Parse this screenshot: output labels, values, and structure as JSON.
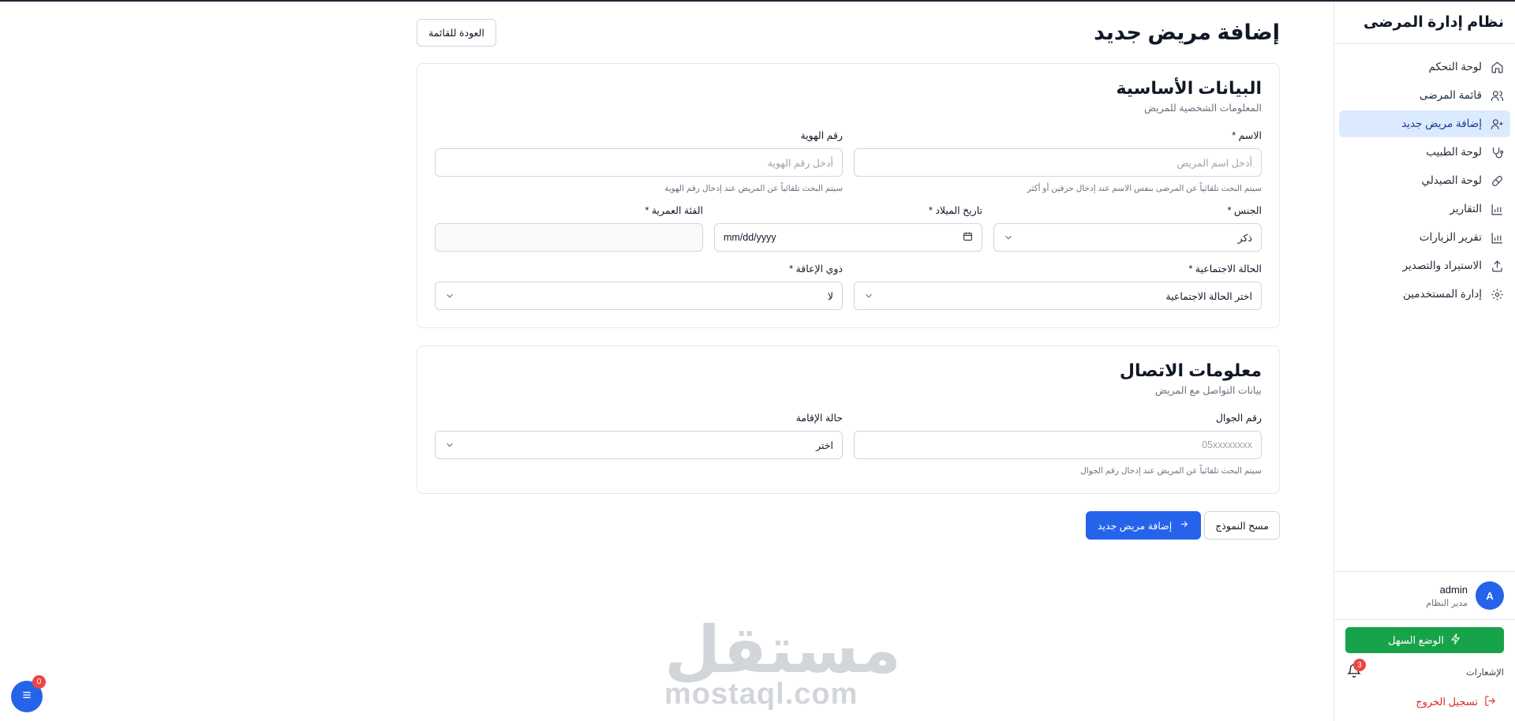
{
  "app": {
    "title": "نظام إدارة المرضى"
  },
  "sidebar": {
    "items": [
      {
        "label": "لوحة التحكم",
        "icon": "home-icon"
      },
      {
        "label": "قائمة المرضى",
        "icon": "users-icon"
      },
      {
        "label": "إضافة مريض جديد",
        "icon": "user-plus-icon",
        "active": true
      },
      {
        "label": "لوحة الطبيب",
        "icon": "stethoscope-icon"
      },
      {
        "label": "لوحة الصيدلي",
        "icon": "pill-icon"
      },
      {
        "label": "التقارير",
        "icon": "bar-chart-icon"
      },
      {
        "label": "تقرير الزيارات",
        "icon": "bar-chart-icon"
      },
      {
        "label": "الاستيراد والتصدير",
        "icon": "upload-icon"
      },
      {
        "label": "إدارة المستخدمين",
        "icon": "gear-icon"
      }
    ],
    "user": {
      "initial": "A",
      "name": "admin",
      "role": "مدير النظام"
    },
    "easy_mode_label": "الوضع السهل",
    "notifications_label": "الإشعارات",
    "notifications_count": "3",
    "logout_label": "تسجيل الخروج"
  },
  "page": {
    "title": "إضافة مريض جديد",
    "back_label": "العودة للقائمة"
  },
  "basic": {
    "title": "البيانات الأساسية",
    "subtitle": "المعلومات الشخصية للمريض",
    "name": {
      "label": "الاسم *",
      "placeholder": "أدخل اسم المريض",
      "hint": "سيتم البحث تلقائياً عن المرضى بنفس الاسم عند إدخال حرفين أو أكثر"
    },
    "id": {
      "label": "رقم الهوية",
      "placeholder": "أدخل رقم الهوية",
      "hint": "سيتم البحث تلقائياً عن المريض عند إدخال رقم الهوية"
    },
    "gender": {
      "label": "الجنس *",
      "value": "ذكر"
    },
    "birth": {
      "label": "تاريخ الميلاد *",
      "value": "mm/dd/yyyy"
    },
    "age_group": {
      "label": "الفئة العمرية *",
      "value": ""
    },
    "social": {
      "label": "الحالة الاجتماعية *",
      "value": "اختر الحالة الاجتماعية"
    },
    "disability": {
      "label": "ذوي الإعاقة *",
      "value": "لا"
    }
  },
  "contact": {
    "title": "معلومات الاتصال",
    "subtitle": "بيانات التواصل مع المريض",
    "phone": {
      "label": "رقم الجوال",
      "placeholder": "05xxxxxxxx",
      "hint": "سيتم البحث تلقائياً عن المريض عند إدخال رقم الجوال"
    },
    "residence": {
      "label": "حالة الإقامة",
      "value": "اختر"
    }
  },
  "actions": {
    "submit_label": "إضافة مريض جديد",
    "clear_label": "مسح النموذج"
  },
  "watermark": {
    "ar": "مستقل",
    "en": "mostaql.com"
  },
  "fab": {
    "badge": "0"
  }
}
